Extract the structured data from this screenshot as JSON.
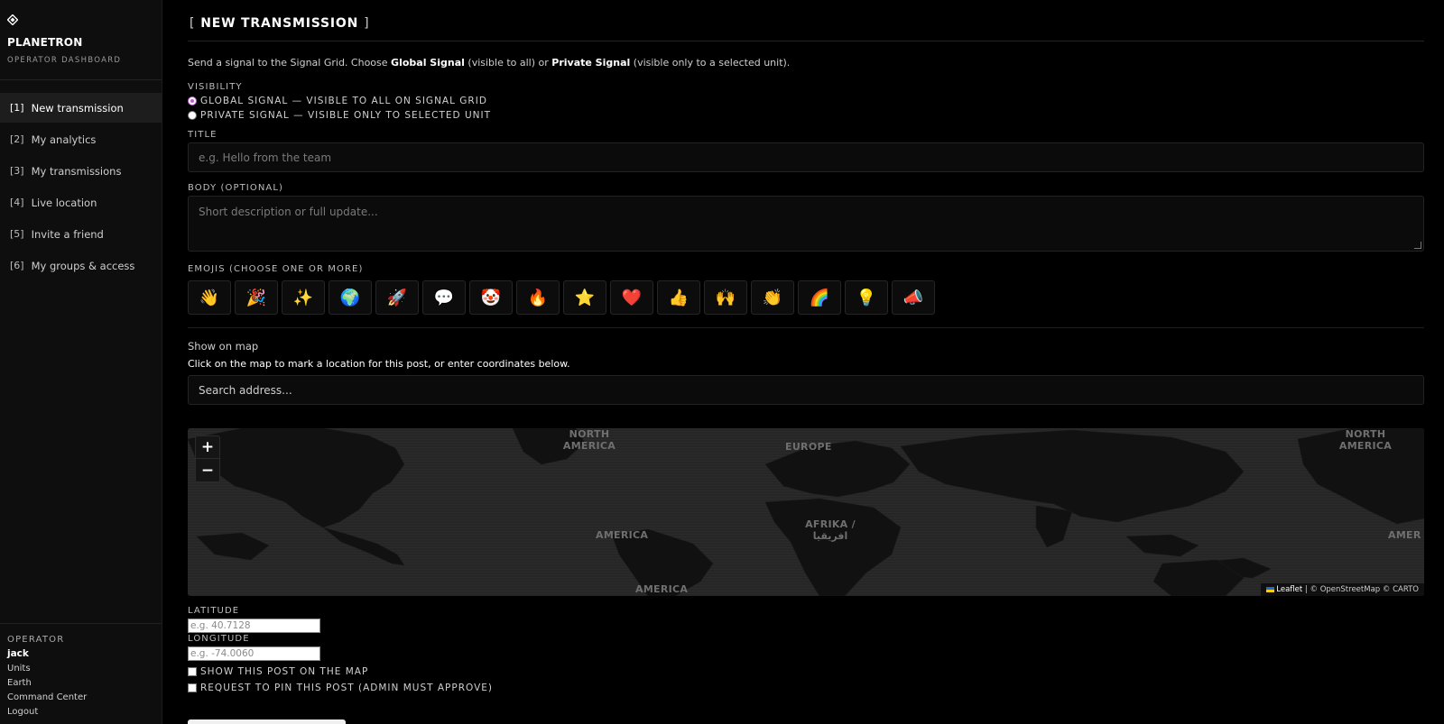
{
  "brand": {
    "icon": "diamond-icon",
    "name": "PLANETRON",
    "subtitle": "OPERATOR DASHBOARD"
  },
  "nav": [
    {
      "num": "[1]",
      "label": "New transmission",
      "active": true
    },
    {
      "num": "[2]",
      "label": "My analytics"
    },
    {
      "num": "[3]",
      "label": "My transmissions"
    },
    {
      "num": "[4]",
      "label": "Live location"
    },
    {
      "num": "[5]",
      "label": "Invite a friend"
    },
    {
      "num": "[6]",
      "label": "My groups & access"
    }
  ],
  "operator": {
    "label": "OPERATOR",
    "user": "jack",
    "links": [
      "Units",
      "Earth",
      "Command Center",
      "Logout"
    ]
  },
  "page": {
    "bracket_open": "[",
    "title": "NEW TRANSMISSION",
    "bracket_close": "]",
    "intro_pre": "Send a signal to the Signal Grid. Choose ",
    "intro_global": "Global Signal",
    "intro_mid": " (visible to all) or ",
    "intro_private": "Private Signal",
    "intro_post": " (visible only to a selected unit)."
  },
  "visibility": {
    "label": "VISIBILITY",
    "options": [
      {
        "label": "GLOBAL SIGNAL — VISIBLE TO ALL ON SIGNAL GRID",
        "checked": true
      },
      {
        "label": "PRIVATE SIGNAL — VISIBLE ONLY TO SELECTED UNIT",
        "checked": false
      }
    ]
  },
  "title_field": {
    "label": "TITLE",
    "placeholder": "e.g. Hello from the team"
  },
  "body_field": {
    "label": "BODY (OPTIONAL)",
    "placeholder": "Short description or full update..."
  },
  "emojis": {
    "label": "EMOJIS (CHOOSE ONE OR MORE)",
    "items": [
      "👋",
      "🎉",
      "✨",
      "🌍",
      "🚀",
      "💬",
      "🤡",
      "🔥",
      "⭐",
      "❤️",
      "👍",
      "🙌",
      "👏",
      "🌈",
      "💡",
      "📣"
    ]
  },
  "map_section": {
    "title": "Show on map",
    "description": "Click on the map to mark a location for this post, or enter coordinates below.",
    "search_placeholder": "Search address...",
    "zoom_in": "+",
    "zoom_out": "−",
    "labels": [
      "NORTH AMERICA",
      "EUROPE",
      "AMERICA",
      "AFRIKA / افريقيا",
      "AMERICA",
      "NORTH AMERICA",
      "AMER"
    ],
    "attribution_leaflet": "Leaflet",
    "attribution_rest": " | © OpenStreetMap © CARTO"
  },
  "latitude": {
    "label": "LATITUDE",
    "placeholder": "e.g. 40.7128"
  },
  "longitude": {
    "label": "LONGITUDE",
    "placeholder": "e.g. -74.0060"
  },
  "checks": [
    {
      "label": "SHOW THIS POST ON THE MAP",
      "checked": false
    },
    {
      "label": "REQUEST TO PIN THIS POST (ADMIN MUST APPROVE)",
      "checked": false
    }
  ]
}
